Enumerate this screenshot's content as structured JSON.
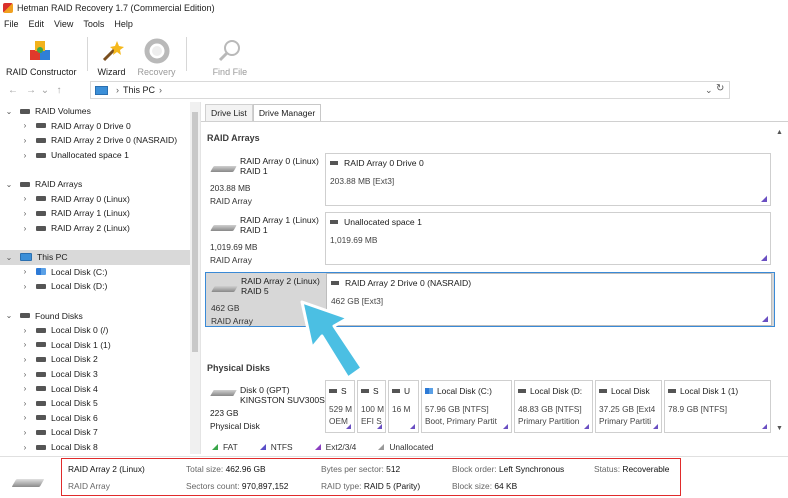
{
  "window": {
    "title": "Hetman RAID Recovery 1.7 (Commercial Edition)"
  },
  "menu": [
    "File",
    "Edit",
    "View",
    "Tools",
    "Help"
  ],
  "toolbar": {
    "raid_constructor": "RAID Constructor",
    "wizard": "Wizard",
    "recovery": "Recovery",
    "find_file": "Find File"
  },
  "address": {
    "path": "This PC"
  },
  "tree": [
    {
      "label": "RAID Volumes",
      "level": 0,
      "expander": "⌄",
      "icon": "drive"
    },
    {
      "label": "RAID Array 0 Drive 0",
      "level": 1,
      "expander": "›",
      "icon": "drive"
    },
    {
      "label": "RAID Array 2 Drive 0 (NASRAID)",
      "level": 1,
      "expander": "›",
      "icon": "drive"
    },
    {
      "label": "Unallocated space 1",
      "level": 1,
      "expander": "›",
      "icon": "drive"
    },
    {
      "label": "",
      "level": 0,
      "expander": "",
      "icon": ""
    },
    {
      "label": "RAID Arrays",
      "level": 0,
      "expander": "⌄",
      "icon": "drive"
    },
    {
      "label": "RAID Array 0 (Linux)",
      "level": 1,
      "expander": "›",
      "icon": "drive"
    },
    {
      "label": "RAID Array 1 (Linux)",
      "level": 1,
      "expander": "›",
      "icon": "drive"
    },
    {
      "label": "RAID Array 2 (Linux)",
      "level": 1,
      "expander": "›",
      "icon": "drive"
    },
    {
      "label": "",
      "level": 0,
      "expander": "",
      "icon": ""
    },
    {
      "label": "This PC",
      "level": 0,
      "expander": "⌄",
      "icon": "pc",
      "selected": true
    },
    {
      "label": "Local Disk (C:)",
      "level": 1,
      "expander": "›",
      "icon": "win"
    },
    {
      "label": "Local Disk (D:)",
      "level": 1,
      "expander": "›",
      "icon": "drive"
    },
    {
      "label": "",
      "level": 0,
      "expander": "",
      "icon": ""
    },
    {
      "label": "Found Disks",
      "level": 0,
      "expander": "⌄",
      "icon": "drive"
    },
    {
      "label": "Local Disk 0 (/)",
      "level": 1,
      "expander": "›",
      "icon": "drive"
    },
    {
      "label": "Local Disk 1 (1)",
      "level": 1,
      "expander": "›",
      "icon": "drive"
    },
    {
      "label": "Local Disk 2",
      "level": 1,
      "expander": "›",
      "icon": "drive"
    },
    {
      "label": "Local Disk 3",
      "level": 1,
      "expander": "›",
      "icon": "drive"
    },
    {
      "label": "Local Disk 4",
      "level": 1,
      "expander": "›",
      "icon": "drive"
    },
    {
      "label": "Local Disk 5",
      "level": 1,
      "expander": "›",
      "icon": "drive"
    },
    {
      "label": "Local Disk 6",
      "level": 1,
      "expander": "›",
      "icon": "drive"
    },
    {
      "label": "Local Disk 7",
      "level": 1,
      "expander": "›",
      "icon": "drive"
    },
    {
      "label": "Local Disk 8",
      "level": 1,
      "expander": "›",
      "icon": "drive"
    }
  ],
  "tabs": [
    "Drive List",
    "Drive Manager"
  ],
  "sections": {
    "raid_arrays": "RAID Arrays",
    "physical_disks": "Physical Disks"
  },
  "arrays": [
    {
      "name": "RAID Array 0 (Linux)",
      "level": "RAID 1",
      "size": "203.88 MB",
      "kind": "RAID Array",
      "part_name": "RAID Array 0 Drive 0",
      "part_fs": "203.88 MB [Ext3]"
    },
    {
      "name": "RAID Array 1 (Linux)",
      "level": "RAID 1",
      "size": "1,019.69 MB",
      "kind": "RAID Array",
      "part_name": "Unallocated space 1",
      "part_fs": "1,019.69 MB"
    },
    {
      "name": "RAID Array 2 (Linux)",
      "level": "RAID 5",
      "size": "462 GB",
      "kind": "RAID Array",
      "part_name": "RAID Array 2 Drive 0 (NASRAID)",
      "part_fs": "462 GB [Ext3]"
    }
  ],
  "physical": {
    "name": "Disk 0 (GPT)",
    "model": "KINGSTON SUV300S",
    "size": "223 GB",
    "kind": "Physical Disk",
    "partitions": [
      {
        "name": "S",
        "l1": "529 M",
        "l2": "OEM",
        "icon": "drive"
      },
      {
        "name": "S",
        "l1": "100 M",
        "l2": "EFI S",
        "icon": "drive"
      },
      {
        "name": "U",
        "l1": "16 M",
        "l2": "",
        "icon": "drive"
      },
      {
        "name": "Local Disk (C:)",
        "l1": "57.96 GB [NTFS]",
        "l2": "Boot, Primary Partit",
        "icon": "win"
      },
      {
        "name": "Local Disk (D:",
        "l1": "48.83 GB [NTFS]",
        "l2": "Primary Partition",
        "icon": "drive"
      },
      {
        "name": "Local Disk",
        "l1": "37.25 GB [Ext4",
        "l2": "Primary Partiti",
        "icon": "drive"
      },
      {
        "name": "Local Disk 1 (1)",
        "l1": "78.9 GB [NTFS]",
        "l2": "",
        "icon": "drive"
      }
    ]
  },
  "legend": [
    {
      "label": "FAT",
      "color": "#3aa64a"
    },
    {
      "label": "NTFS",
      "color": "#5a4fc8"
    },
    {
      "label": "Ext2/3/4",
      "color": "#8a3fc0"
    },
    {
      "label": "Unallocated",
      "color": "#9a9a9a"
    }
  ],
  "status": {
    "name": "RAID Array 2 (Linux)",
    "kind": "RAID Array",
    "total_size_label": "Total size:",
    "total_size": "462.96 GB",
    "sectors_label": "Sectors count:",
    "sectors": "970,897,152",
    "bps_label": "Bytes per sector:",
    "bps": "512",
    "raid_type_label": "RAID type:",
    "raid_type": "RAID 5 (Parity)",
    "block_order_label": "Block order:",
    "block_order": "Left Synchronous",
    "block_size_label": "Block size:",
    "block_size": "64 KB",
    "status_label": "Status:",
    "status_value": "Recoverable"
  }
}
